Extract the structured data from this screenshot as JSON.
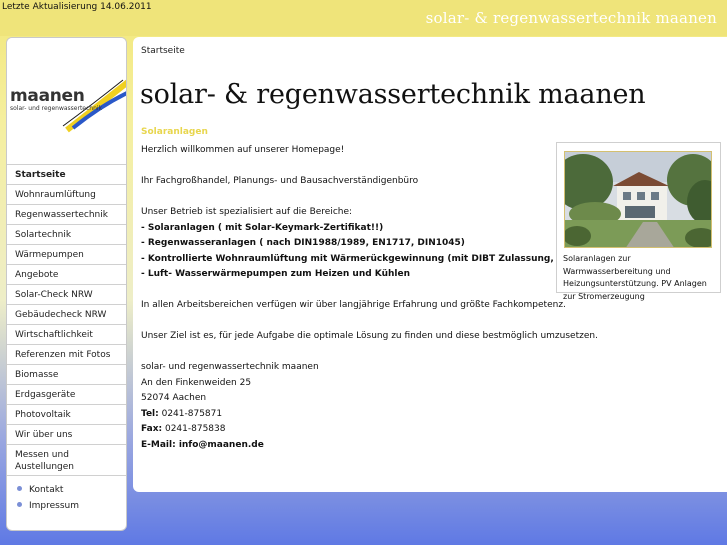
{
  "header": {
    "update_note": "Letzte Aktualisierung 14.06.2011",
    "site_title": "solar- & regenwassertechnik maanen"
  },
  "logo": {
    "word": "maanen",
    "subtitle": "solar- und regenwassertechnik",
    "colors": [
      "#f0d020",
      "#2a58c8",
      "#1a1a1a"
    ]
  },
  "nav": {
    "items": [
      {
        "label": "Startseite",
        "active": true
      },
      {
        "label": "Wohnraumlüftung"
      },
      {
        "label": "Regenwassertechnik"
      },
      {
        "label": "Solartechnik"
      },
      {
        "label": "Wärmepumpen"
      },
      {
        "label": "Angebote"
      },
      {
        "label": "Solar-Check NRW"
      },
      {
        "label": "Gebäudecheck NRW"
      },
      {
        "label": "Wirtschaftlichkeit"
      },
      {
        "label": "Referenzen mit Fotos"
      },
      {
        "label": "Biomasse"
      },
      {
        "label": "Erdgasgeräte"
      },
      {
        "label": "Photovoltaik"
      },
      {
        "label": "Wir über uns"
      },
      {
        "label": "Messen und Austellungen"
      }
    ],
    "bullets": [
      "Kontakt",
      "Impressum"
    ]
  },
  "main": {
    "breadcrumb": "Startseite",
    "title": "solar- & regenwassertechnik maanen",
    "section_title": "Solaranlagen",
    "intro": "Herzlich willkommen auf unserer Homepage!",
    "tagline": "Ihr Fachgroßhandel, Planungs- und Bausachverständigenbüro",
    "services_intro": "Unser Betrieb ist spezialisiert auf die Bereiche:",
    "services": [
      "- Solaranlagen ( mit Solar-Keymark-Zertifikat!!)",
      "- Regenwasseranlagen ( nach DIN1988/1989, EN1717, DIN1045)",
      "- Kontrollierte Wohnraumlüftung mit Wärmerückgewinnung (mit DIBT Zulassung, TÜV geprüft)",
      "- Luft- Wasserwärmepumpen zum Heizen und Kühlen"
    ],
    "experience": "In allen Arbeitsbereichen verfügen wir über langjährige Erfahrung und größte Fachkompetenz.",
    "goal": "Unser Ziel ist es, für jede Aufgabe die optimale Lösung zu finden und diese bestmöglich umzusetzen.",
    "address": {
      "company": "solar- und regenwassertechnik maanen",
      "street": "An den Finkenweiden 25",
      "city": "52074 Aachen",
      "tel_label": "Tel:",
      "tel": " 0241-875871",
      "fax_label": "Fax:",
      "fax": " 0241-875838",
      "email": "E-Mail: info@maanen.de"
    },
    "image_caption": "Solaranlagen zur Warmwasserbereitung und Heizungsunterstützung. PV Anlagen zur Stromerzeugung"
  },
  "colors": {
    "header_yellow": "#efe47a",
    "section_title": "#e8d64e",
    "bullet": "#7b8fd6",
    "bg_blue": "#5f79e4"
  }
}
